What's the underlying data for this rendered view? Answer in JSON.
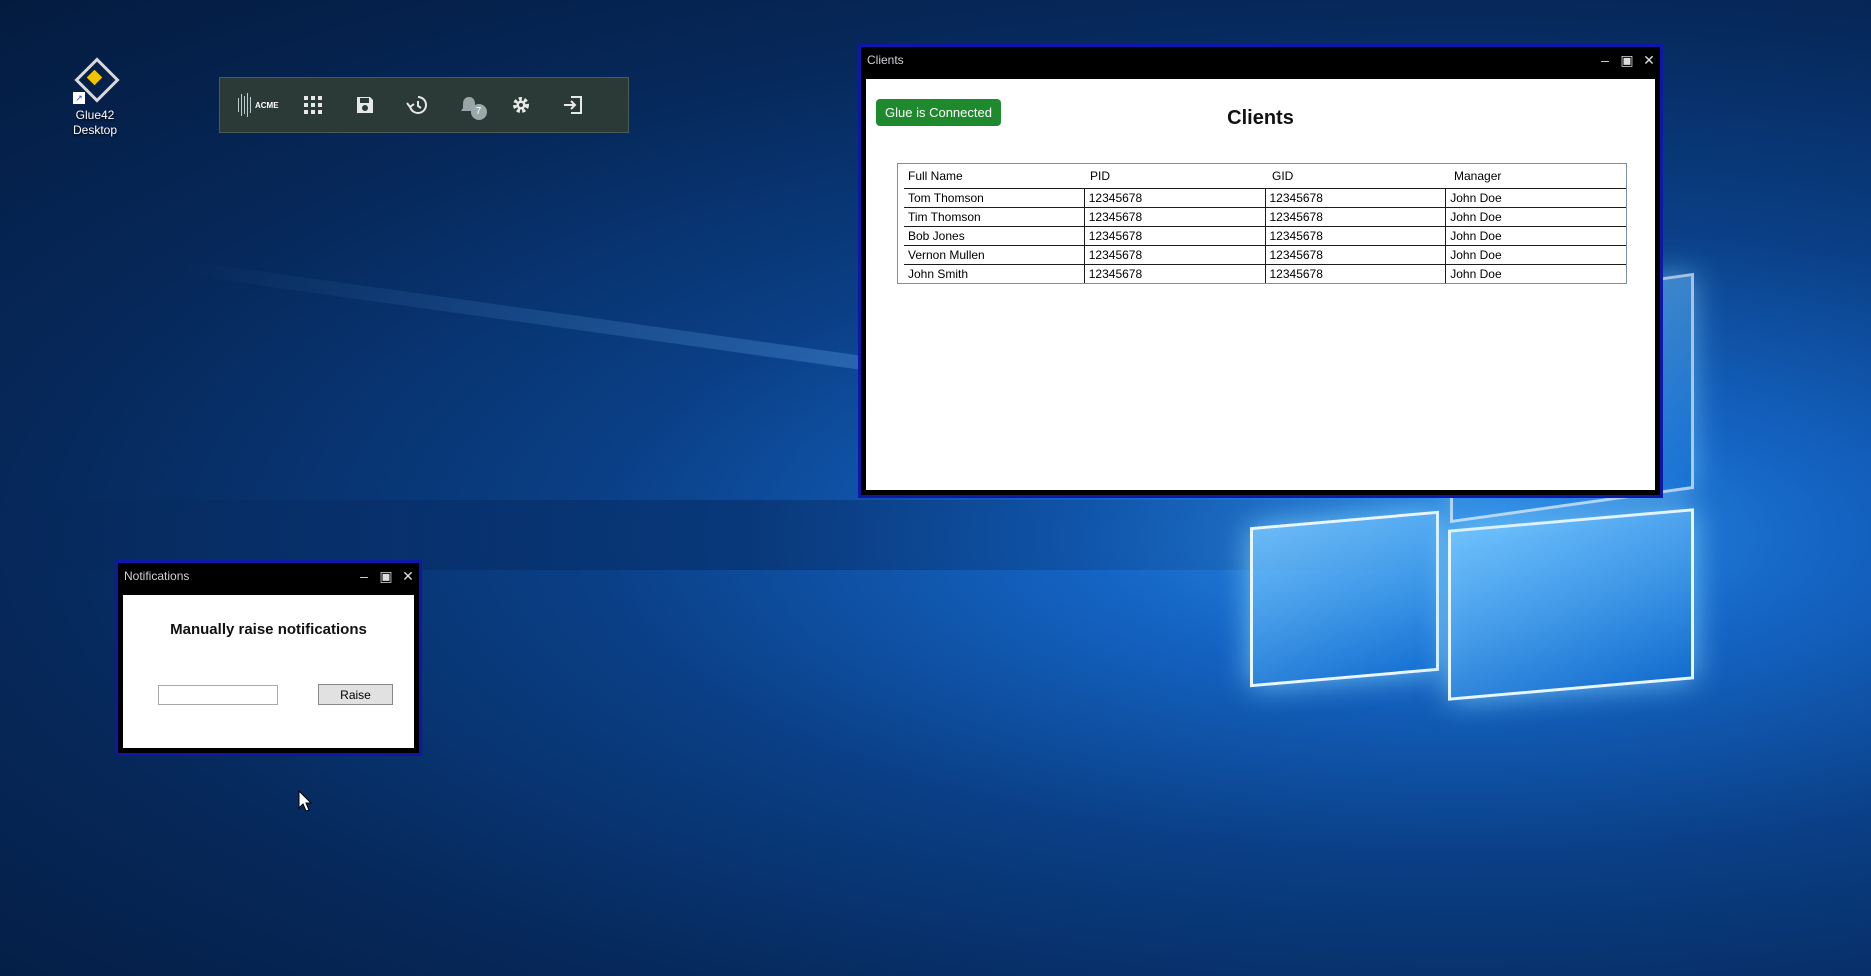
{
  "desktop": {
    "icon": {
      "label_line1": "Glue42",
      "label_line2": "Desktop",
      "icon": "glue42-logo-icon"
    }
  },
  "toolbar": {
    "brand": "ACME",
    "buttons": [
      {
        "name": "apps-grid-icon"
      },
      {
        "name": "save-icon"
      },
      {
        "name": "history-icon"
      },
      {
        "name": "notifications-icon",
        "badge": "7"
      },
      {
        "name": "gear-icon"
      },
      {
        "name": "exit-icon"
      }
    ]
  },
  "clients_window": {
    "title": "Clients",
    "status_label": "Glue is Connected",
    "heading": "Clients",
    "columns": [
      "Full Name",
      "PID",
      "GID",
      "Manager"
    ],
    "rows": [
      [
        "Tom Thomson",
        "12345678",
        "12345678",
        "John Doe"
      ],
      [
        "Tim Thomson",
        "12345678",
        "12345678",
        "John Doe"
      ],
      [
        "Bob Jones",
        "12345678",
        "12345678",
        "John Doe"
      ],
      [
        "Vernon Mullen",
        "12345678",
        "12345678",
        "John Doe"
      ],
      [
        "John Smith",
        "12345678",
        "12345678",
        "John Doe"
      ]
    ]
  },
  "notifications_window": {
    "title": "Notifications",
    "heading": "Manually raise notifications",
    "input_value": "",
    "raise_label": "Raise"
  },
  "colors": {
    "window_border": "#0e17a8",
    "status_green": "#1f8a2d",
    "toolbar_bg": "#2b3a36"
  }
}
